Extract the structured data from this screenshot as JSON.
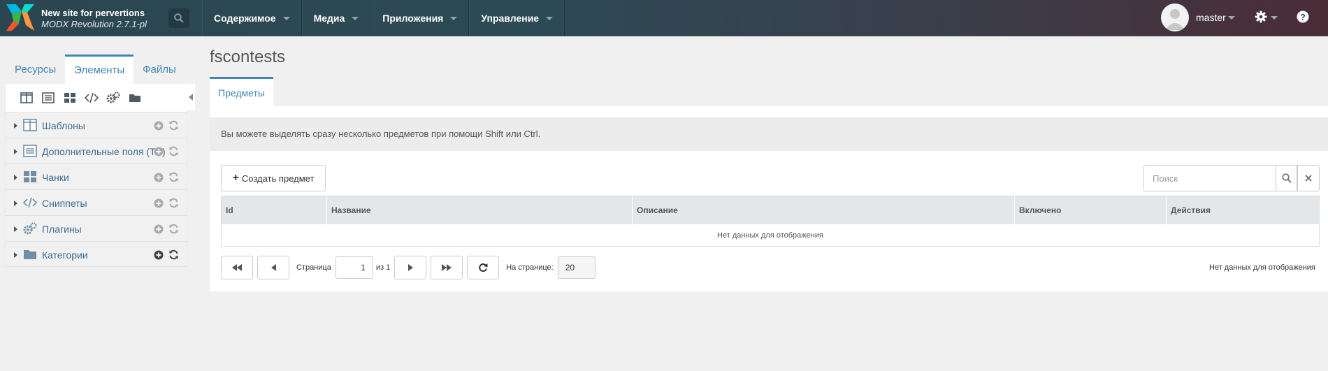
{
  "header": {
    "site_title": "New site for pervertions",
    "version": "MODX Revolution 2.7.1-pl",
    "nav": [
      {
        "label": "Содержимое"
      },
      {
        "label": "Медиа"
      },
      {
        "label": "Приложения"
      },
      {
        "label": "Управление"
      }
    ],
    "username": "master"
  },
  "sidebar": {
    "tabs": [
      {
        "label": "Ресурсы",
        "active": false
      },
      {
        "label": "Элементы",
        "active": true
      },
      {
        "label": "Файлы",
        "active": false
      }
    ],
    "tree": [
      {
        "label": "Шаблоны",
        "icon": "templates-icon"
      },
      {
        "label": "Дополнительные поля (TV)",
        "icon": "tv-icon"
      },
      {
        "label": "Чанки",
        "icon": "chunks-icon"
      },
      {
        "label": "Сниппеты",
        "icon": "snippets-icon"
      },
      {
        "label": "Плагины",
        "icon": "plugins-icon"
      },
      {
        "label": "Категории",
        "icon": "folder-icon"
      }
    ]
  },
  "main": {
    "title": "fscontests",
    "tab": "Предметы",
    "info": "Вы можете выделять сразу несколько предметов при помощи Shift или Ctrl.",
    "create_button": "Создать предмет",
    "search_placeholder": "Поиск",
    "columns": [
      "Id",
      "Название",
      "Описание",
      "Включено",
      "Действия"
    ],
    "empty_text": "Нет данных для отображения",
    "pager": {
      "page_label": "Страница",
      "page_value": "1",
      "of_label": "из 1",
      "per_page_label": "На странице:",
      "per_page_value": "20",
      "status": "Нет данных для отображения"
    }
  },
  "colors": {
    "accent": "#3f86b8",
    "header_start": "#2b4650",
    "header_end": "#4a2c37"
  }
}
